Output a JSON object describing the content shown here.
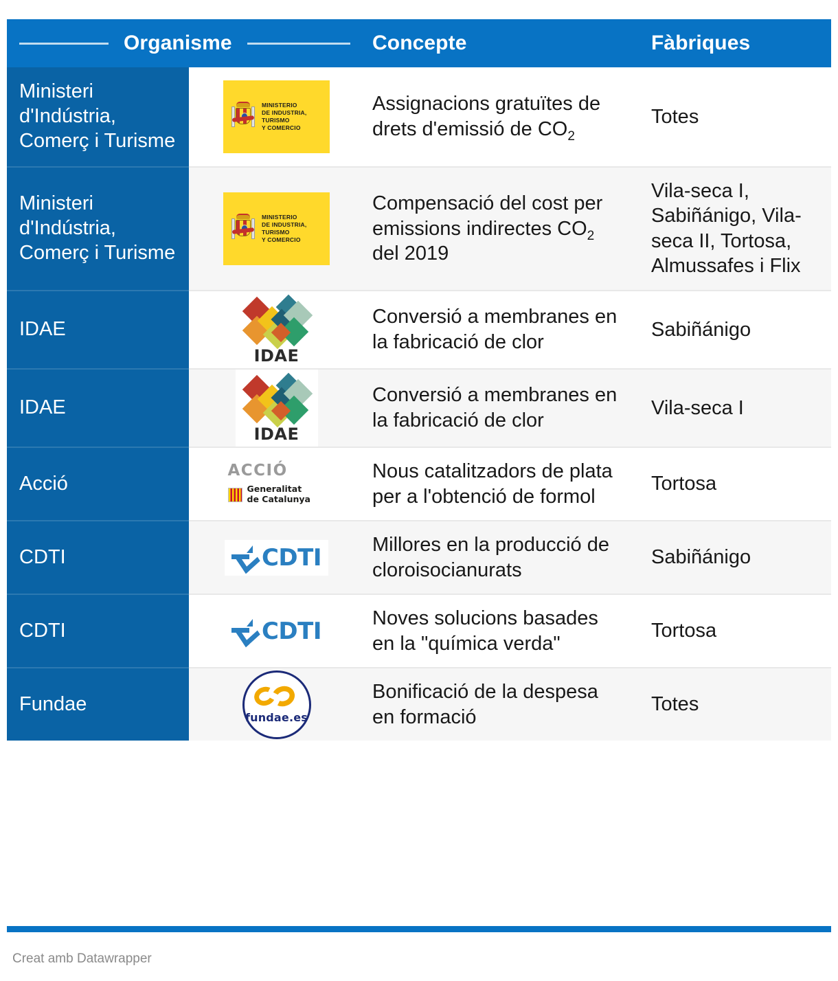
{
  "table": {
    "columns": [
      {
        "key": "organisme",
        "label": "Organisme",
        "has_rules": true
      },
      {
        "key": "concepte",
        "label": "Concepte",
        "has_rules": false
      },
      {
        "key": "fabriques",
        "label": "Fàbriques",
        "has_rules": false
      }
    ],
    "rows": [
      {
        "organisme": "Ministeri d'Indústria, Comerç i Turisme",
        "logo": "ministerio-industria-turismo-comercio-logo",
        "logo_text_lines": [
          "MINISTERIO",
          "DE INDUSTRIA, TURISMO",
          "Y COMERCIO"
        ],
        "concepte_pre": "Assignacions gratuïtes de drets d'emissió de CO",
        "concepte_sub": "2",
        "concepte_post": "",
        "fabriques": "Totes"
      },
      {
        "organisme": "Ministeri d'Indústria, Comerç i Turisme",
        "logo": "ministerio-industria-turismo-comercio-logo",
        "logo_text_lines": [
          "MINISTERIO",
          "DE INDUSTRIA, TURISMO",
          "Y COMERCIO"
        ],
        "concepte_pre": "Compensació del cost per emissions indirectes CO",
        "concepte_sub": "2",
        "concepte_post": " del 2019",
        "fabriques": "Vila-seca I, Sabiñánigo, Vila-seca II, Tortosa, Almussafes i Flix"
      },
      {
        "organisme": "IDAE",
        "logo": "idae-logo",
        "logo_text_lines": [
          "IDAE"
        ],
        "concepte_pre": "Conversió a membranes en la fabricació de clor",
        "concepte_sub": "",
        "concepte_post": "",
        "fabriques": "Sabiñánigo"
      },
      {
        "organisme": "IDAE",
        "logo": "idae-logo",
        "logo_text_lines": [
          "IDAE"
        ],
        "concepte_pre": "Conversió a membranes en la fabricació de clor",
        "concepte_sub": "",
        "concepte_post": "",
        "fabriques": "Vila-seca I"
      },
      {
        "organisme": "Acció",
        "logo": "accio-generalitat-de-catalunya-logo",
        "logo_text_lines": [
          "ACCIÓ",
          "Generalitat",
          "de Catalunya"
        ],
        "concepte_pre": "Nous catalitzadors de plata per a l'obtenció de formol",
        "concepte_sub": "",
        "concepte_post": "",
        "fabriques": "Tortosa"
      },
      {
        "organisme": "CDTI",
        "logo": "cdti-logo",
        "logo_text_lines": [
          "CDTI"
        ],
        "concepte_pre": "Millores en la producció de cloroisocianurats",
        "concepte_sub": "",
        "concepte_post": "",
        "fabriques": "Sabiñánigo"
      },
      {
        "organisme": "CDTI",
        "logo": "cdti-logo",
        "logo_text_lines": [
          "CDTI"
        ],
        "concepte_pre": "Noves solucions basades en la \"química verda\"",
        "concepte_sub": "",
        "concepte_post": "",
        "fabriques": "Tortosa"
      },
      {
        "organisme": "Fundae",
        "logo": "fundae-logo",
        "logo_text_lines": [
          "fundae.es"
        ],
        "concepte_pre": "Bonificació de la despesa en formació",
        "concepte_sub": "",
        "concepte_post": "",
        "fabriques": "Totes"
      }
    ]
  },
  "footer": {
    "credit": "Creat amb Datawrapper"
  },
  "colors": {
    "header_blue": "#0873c4",
    "column_blue": "#0a63a5",
    "row_white": "#ffffff",
    "row_gray": "#f6f6f6",
    "text_dark": "#181818",
    "footer_gray": "#8a8a8a"
  }
}
